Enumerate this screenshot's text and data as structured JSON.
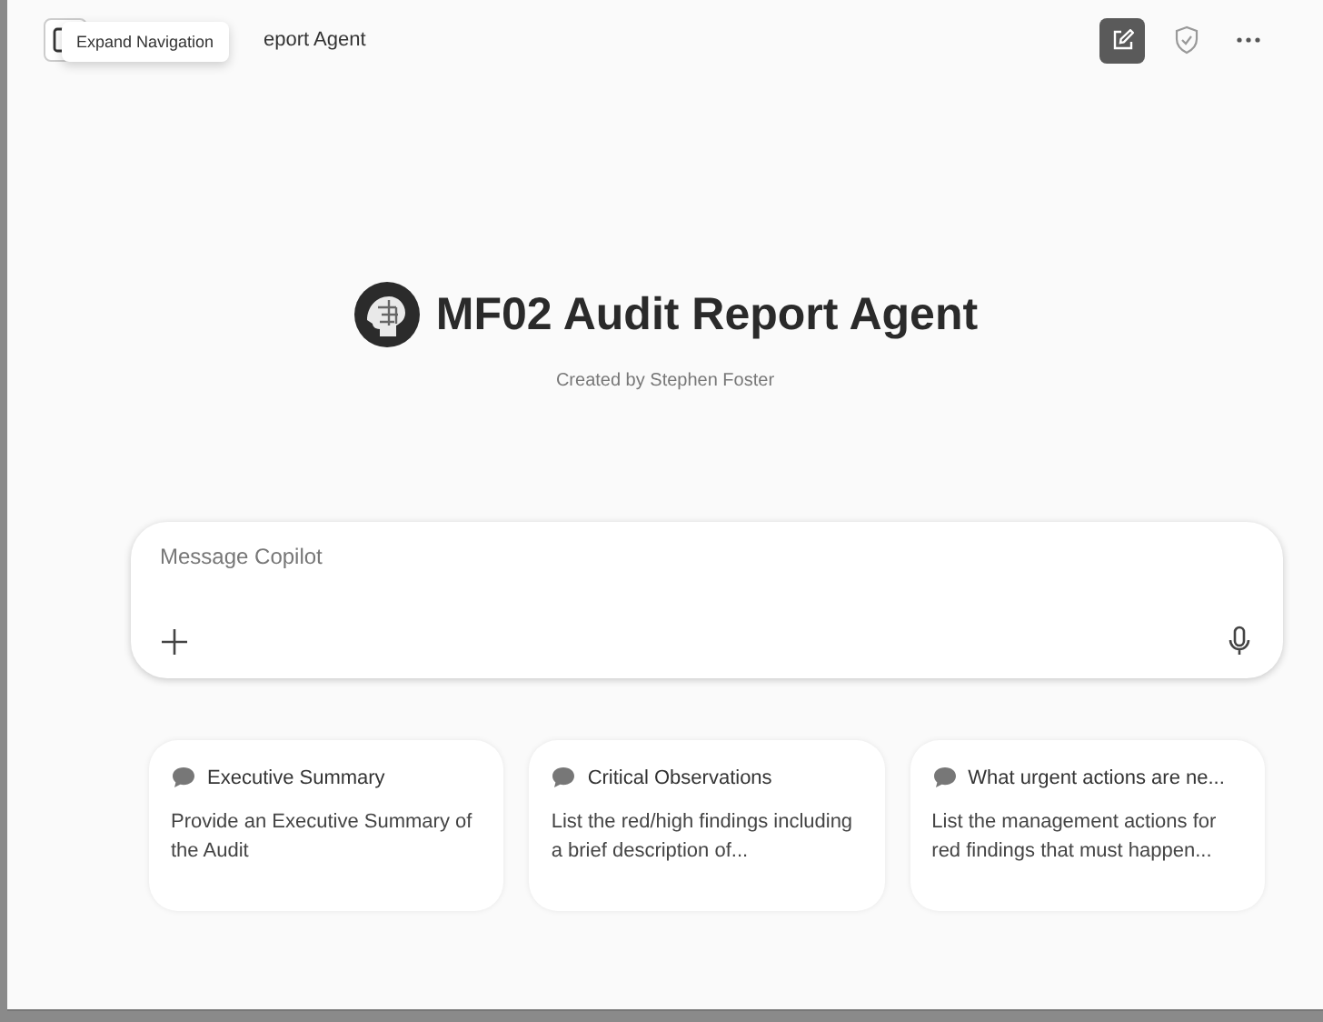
{
  "header": {
    "title": "eport Agent",
    "tooltip": "Expand Navigation"
  },
  "agent": {
    "name": "MF02 Audit Report Agent",
    "creator": "Created by Stephen Foster"
  },
  "composer": {
    "placeholder": "Message Copilot"
  },
  "prompts": [
    {
      "title": "Executive Summary",
      "text": "Provide an Executive Summary of the Audit"
    },
    {
      "title": "Critical Observations",
      "text": "List the red/high findings including a brief description of..."
    },
    {
      "title": "What urgent actions are ne...",
      "text": "List the management actions for red findings that must happen..."
    }
  ]
}
